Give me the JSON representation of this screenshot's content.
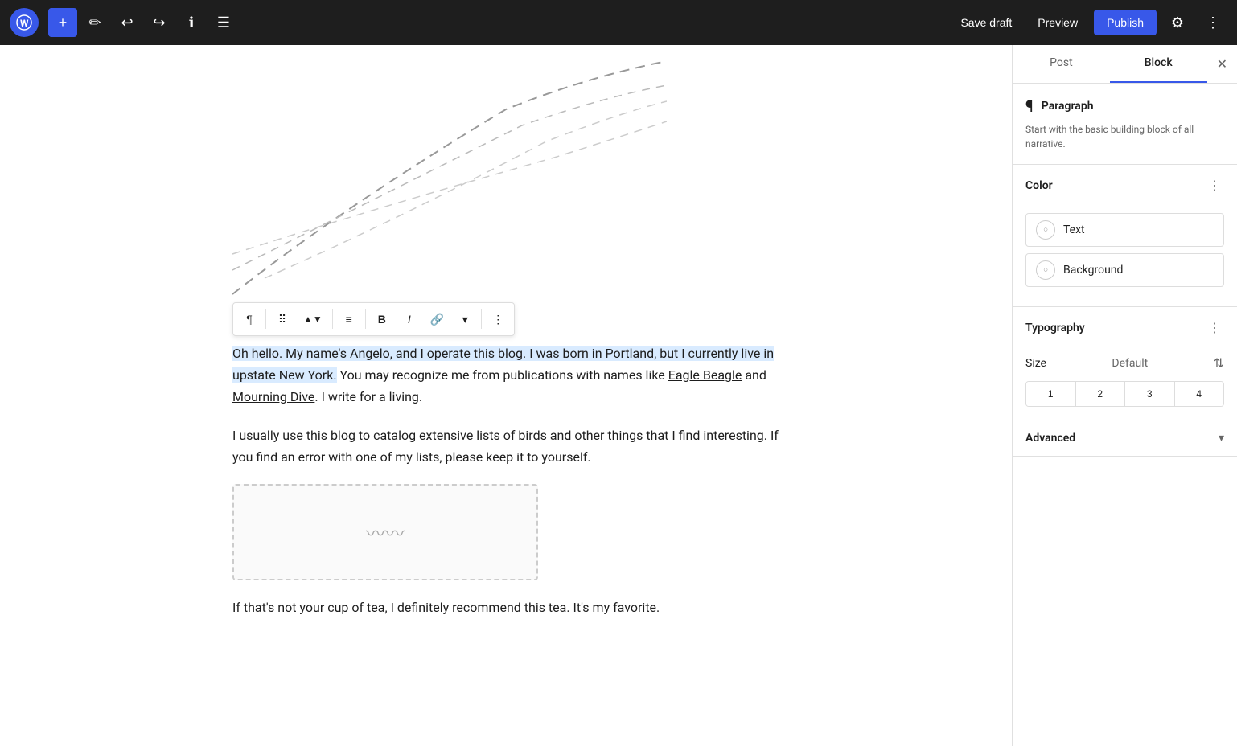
{
  "toolbar": {
    "add_label": "+",
    "save_draft_label": "Save draft",
    "preview_label": "Preview",
    "publish_label": "Publish"
  },
  "block_toolbar": {
    "buttons": [
      {
        "id": "block-type",
        "label": "¶",
        "tooltip": "Paragraph"
      },
      {
        "id": "drag",
        "label": "⠿",
        "tooltip": "Drag"
      },
      {
        "id": "move-up-down",
        "label": "⬆⬇",
        "tooltip": "Move up/down"
      },
      {
        "id": "align",
        "label": "≡",
        "tooltip": "Align"
      },
      {
        "id": "bold",
        "label": "B",
        "tooltip": "Bold"
      },
      {
        "id": "italic",
        "label": "I",
        "tooltip": "Italic"
      },
      {
        "id": "link",
        "label": "🔗",
        "tooltip": "Link"
      },
      {
        "id": "more-rich",
        "label": "▾",
        "tooltip": "More options"
      },
      {
        "id": "options",
        "label": "⋮",
        "tooltip": "Options"
      }
    ]
  },
  "content": {
    "paragraph1_selected": "Oh hello. My name's Angelo, and I operate this blog. I was born in Portland, but I currently live in upstate New York.",
    "paragraph1_rest": " You may recognize me from publications with names like ",
    "paragraph1_link1": "Eagle Beagle",
    "paragraph1_and": " and ",
    "paragraph1_link2": "Mourning Dive",
    "paragraph1_end": ". I write for a living.",
    "paragraph2": "I usually use this blog to catalog extensive lists of birds and other things that I find interesting. If you find an error with one of my lists, please keep it to yourself.",
    "paragraph3_start": "If that's not your cup of tea, ",
    "paragraph3_link": "I definitely recommend this tea",
    "paragraph3_end": ". It's my favorite."
  },
  "sidebar": {
    "tabs": {
      "post_label": "Post",
      "block_label": "Block"
    },
    "block_info": {
      "title": "Paragraph",
      "description": "Start with the basic building block of all narrative."
    },
    "color_section": {
      "title": "Color",
      "text_label": "Text",
      "background_label": "Background"
    },
    "typography_section": {
      "title": "Typography",
      "size_label": "Size",
      "size_value": "Default",
      "font_sizes": [
        "1",
        "2",
        "3",
        "4"
      ]
    },
    "advanced_section": {
      "title": "Advanced"
    }
  }
}
